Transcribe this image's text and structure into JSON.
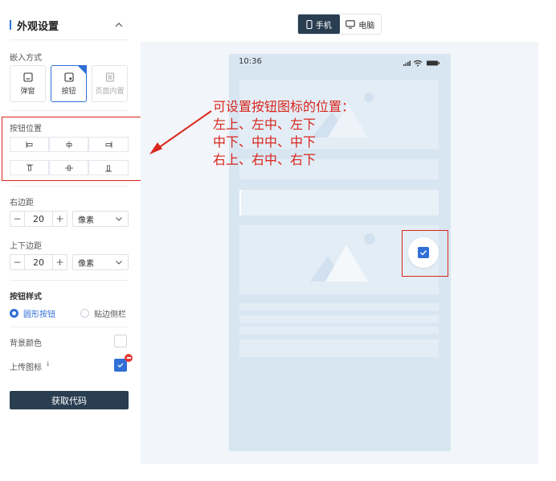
{
  "panel": {
    "title": "外观设置",
    "embed_mode_label": "嵌入方式",
    "embed_modes": [
      {
        "label": "弹窗",
        "icon": "popup-icon",
        "selected": false,
        "disabled": false
      },
      {
        "label": "按钮",
        "icon": "button-icon",
        "selected": true,
        "disabled": false
      },
      {
        "label": "页面内置",
        "icon": "page-embed-icon",
        "selected": false,
        "disabled": true
      }
    ],
    "button_position_label": "按钮位置",
    "right_margin_label": "右边距",
    "right_margin_value": "20",
    "right_margin_unit": "像素",
    "vertical_margin_label": "上下边距",
    "vertical_margin_value": "20",
    "vertical_margin_unit": "像素",
    "button_style_label": "按钮样式",
    "button_styles": [
      {
        "label": "圆形按钮",
        "checked": true
      },
      {
        "label": "贴边侧栏",
        "checked": false
      }
    ],
    "background_color_label": "背景颜色",
    "upload_icon_label": "上传图标",
    "get_code_label": "获取代码"
  },
  "device_toggle": {
    "options": [
      {
        "label": "手机",
        "icon": "phone-icon",
        "active": true
      },
      {
        "label": "电脑",
        "icon": "monitor-icon",
        "active": false
      }
    ]
  },
  "phone": {
    "time": "10:36"
  },
  "annotation": {
    "lines": [
      "可设置按钮图标的位置：",
      "左上、左中、左下",
      "中下、中中、中下",
      "右上、右中、右下"
    ]
  },
  "colors": {
    "accent": "#2f6fd6",
    "primary_dark": "#2a3e52",
    "annotation_red": "#d9261c",
    "phone_bg": "#d8e6f2",
    "preview_bg": "#f2f5f9"
  }
}
